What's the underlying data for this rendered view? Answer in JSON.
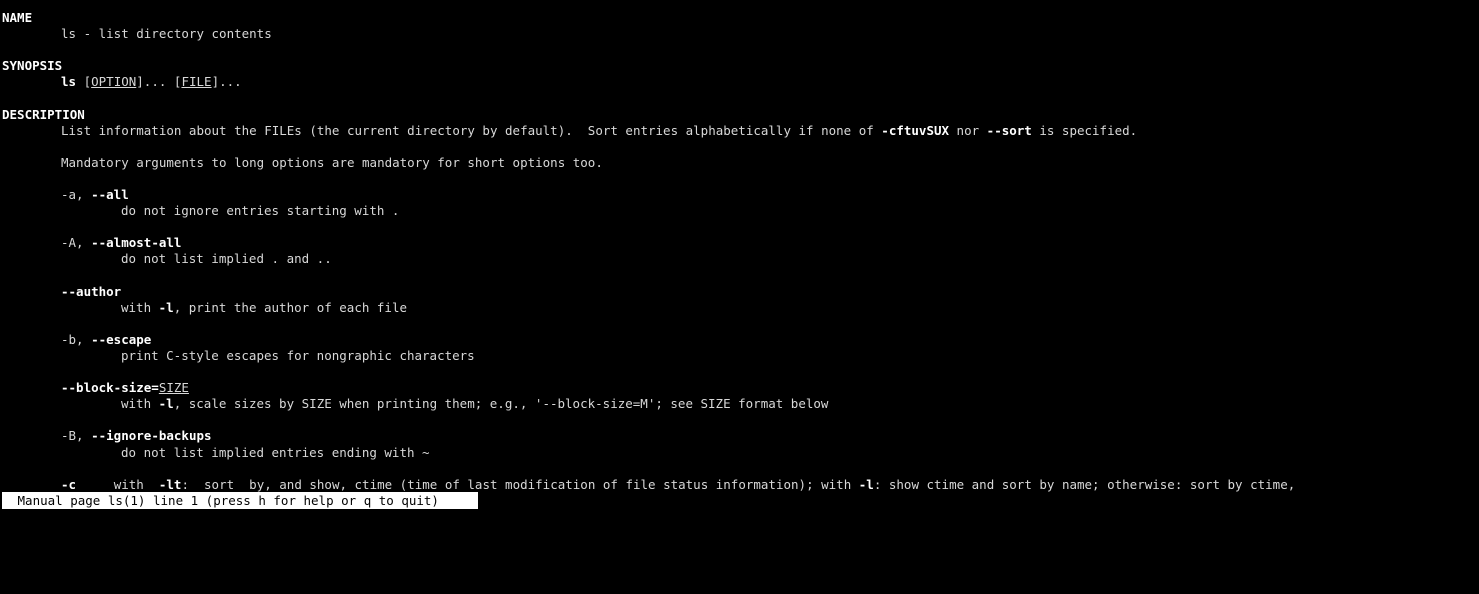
{
  "sections": {
    "name_heading": "NAME",
    "name_text": "ls - list directory contents",
    "synopsis_heading": "SYNOPSIS",
    "synopsis": {
      "cmd": "ls",
      "open1": "[",
      "arg1": "OPTION",
      "close1": "]... ",
      "open2": "[",
      "arg2": "FILE",
      "close2": "]..."
    },
    "description_heading": "DESCRIPTION",
    "desc_line1": {
      "pre": "List information about the FILEs (the current directory by default).  Sort entries alphabetically if none of ",
      "flag": "-cftuvSUX",
      "mid": " nor ",
      "flag2": "--sort",
      "post": " is specified."
    },
    "desc_line2": "Mandatory arguments to long options are mandatory for short options too."
  },
  "options": [
    {
      "short": "-a, ",
      "long": "--all",
      "desc": "do not ignore entries starting with ."
    },
    {
      "short": "-A, ",
      "long": "--almost-all",
      "desc": "do not list implied . and .."
    },
    {
      "short": "",
      "long": "--author",
      "desc_pre": "with ",
      "desc_flag": "-l",
      "desc_post": ", print the author of each file"
    },
    {
      "short": "-b, ",
      "long": "--escape",
      "desc": "print C-style escapes for nongraphic characters"
    },
    {
      "long": "--block-size=",
      "arg": "SIZE",
      "desc_pre": "with ",
      "desc_flag": "-l",
      "desc_post": ", scale sizes by SIZE when printing them; e.g., '--block-size=M'; see SIZE format below"
    },
    {
      "short": "-B, ",
      "long": "--ignore-backups",
      "desc": "do not list implied entries ending with ~"
    },
    {
      "flag": "-c",
      "gap": "     with  ",
      "flag2": "-lt",
      "text1": ":  sort  by, and show, ctime (time of last modification of file status information); with ",
      "flag3": "-l",
      "text2": ": show ctime and sort by name; otherwise: sort by ctime,"
    }
  ],
  "status_bar": " Manual page ls(1) line 1 (press h for help or q to quit)"
}
